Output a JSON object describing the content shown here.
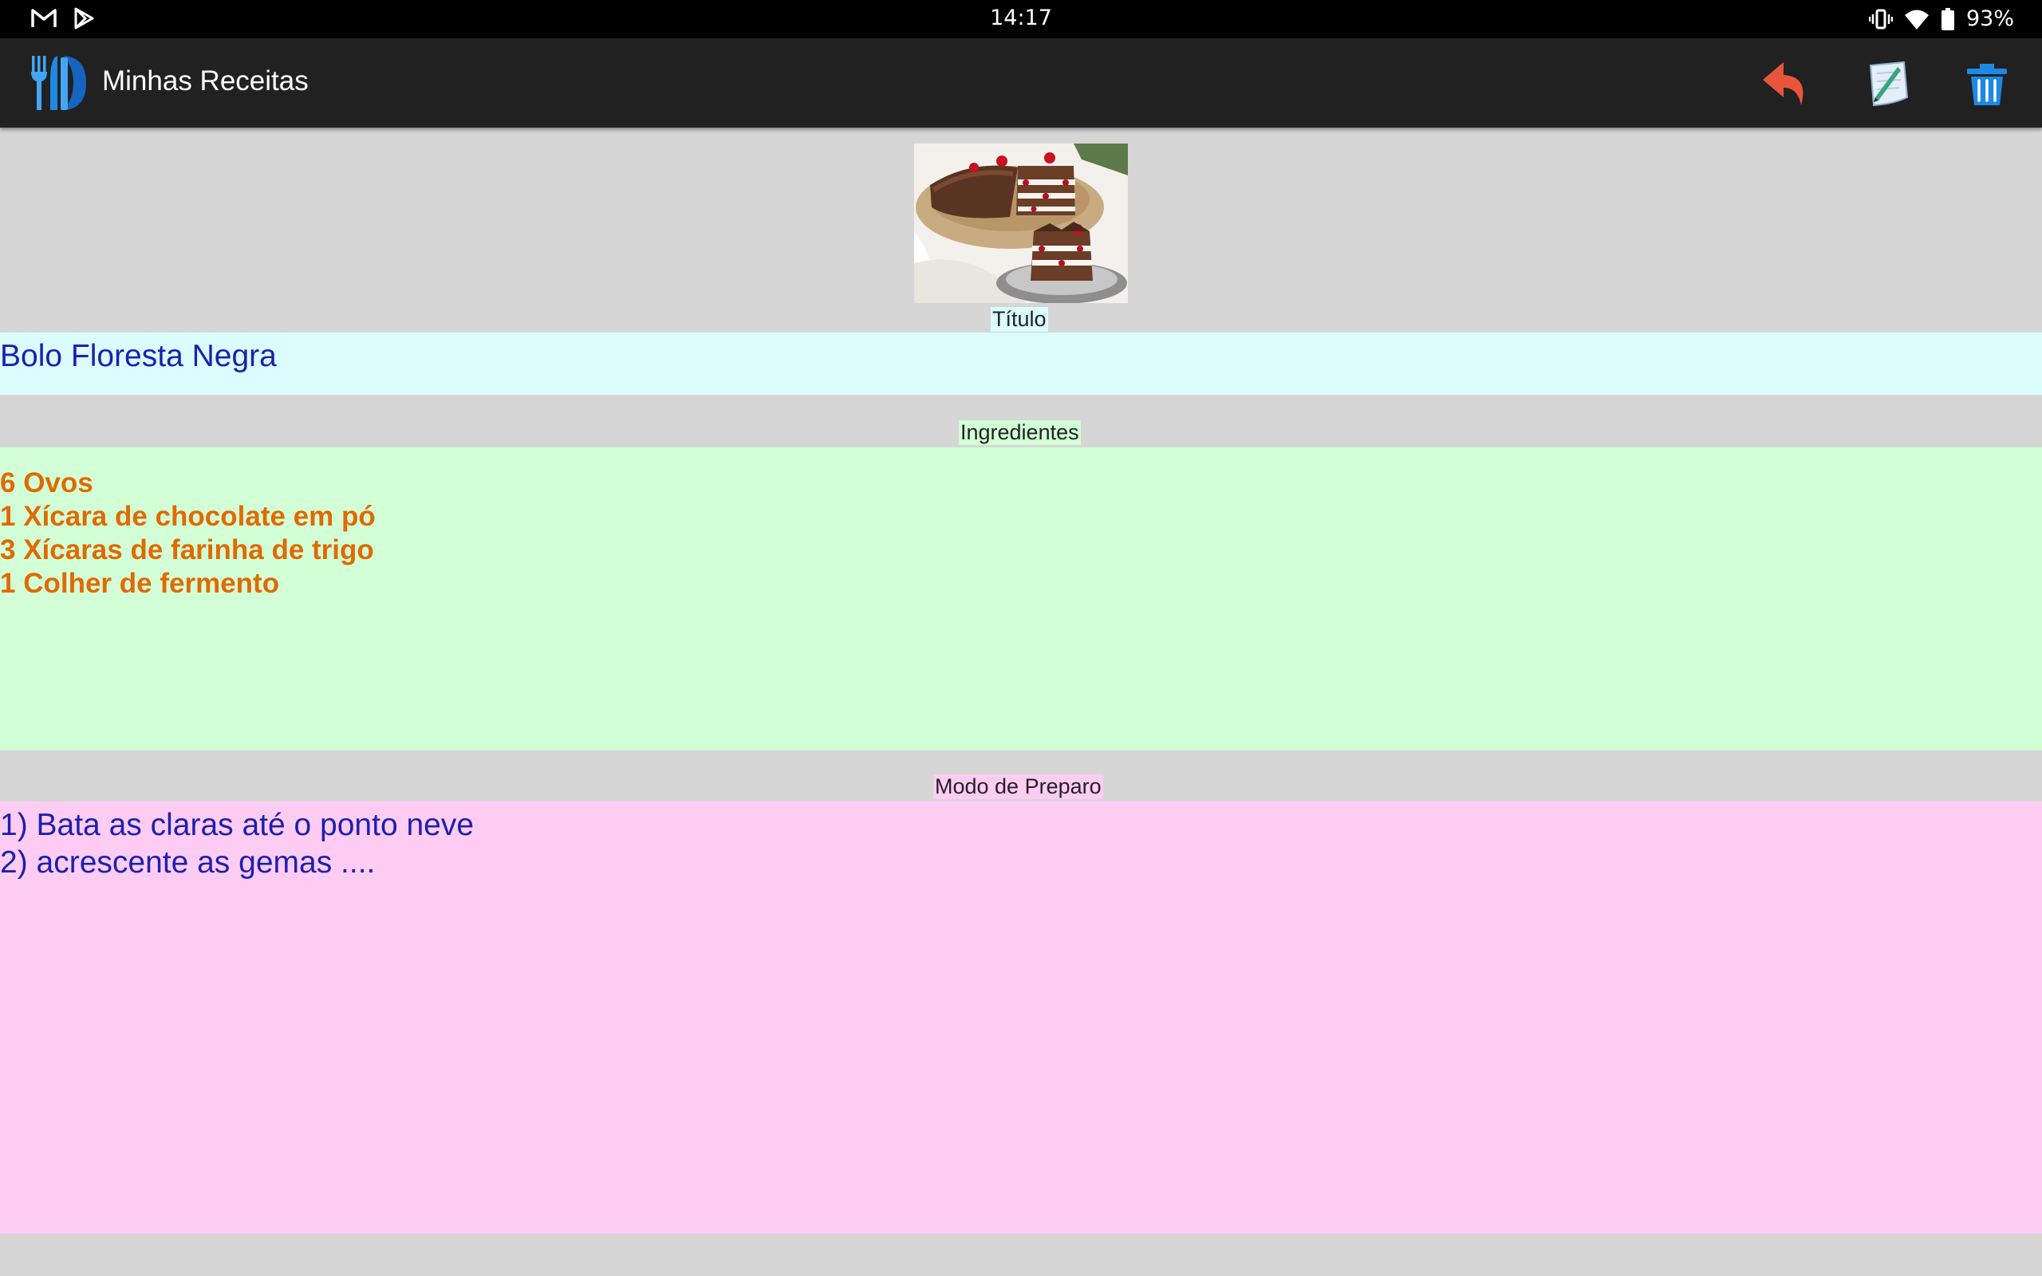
{
  "status_bar": {
    "time": "14:17",
    "battery": "93%",
    "left_icons": [
      "gmail-icon",
      "play-store-icon"
    ],
    "right_icons": [
      "vibrate-icon",
      "wifi-icon",
      "battery-icon"
    ]
  },
  "toolbar": {
    "title": "Minhas Receitas",
    "actions": [
      "undo-icon",
      "edit-note-icon",
      "trash-icon"
    ],
    "colors": {
      "undo": "#e8553a",
      "delete": "#1e88e5"
    }
  },
  "recipe": {
    "title_label": "Título",
    "title": "Bolo Floresta Negra",
    "ingredients_label": "Ingredientes",
    "ingredients": [
      "6 Ovos",
      "1 Xícara de chocolate em pó",
      "3 Xícaras de farinha de trigo",
      "1 Colher de fermento"
    ],
    "preparation_label": "Modo de Preparo",
    "preparation": [
      "1) Bata as claras até o ponto neve",
      "2) acrescente as gemas ...."
    ]
  }
}
